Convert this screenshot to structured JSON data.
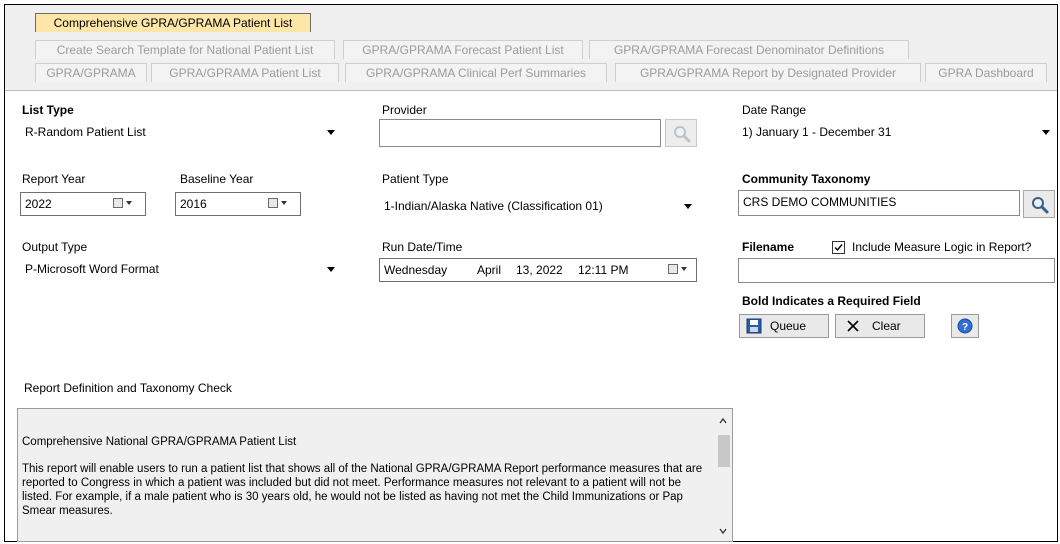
{
  "tabs": {
    "row1": [
      "Comprehensive GPRA/GPRAMA Patient List"
    ],
    "row2": [
      "Create Search Template for National Patient List",
      "GPRA/GPRAMA Forecast Patient List",
      "GPRA/GPRAMA Forecast Denominator Definitions"
    ],
    "row3": [
      "GPRA/GPRAMA",
      "GPRA/GPRAMA Patient List",
      "GPRA/GPRAMA Clinical Perf Summaries",
      "GPRA/GPRAMA Report by Designated Provider",
      "GPRA Dashboard"
    ]
  },
  "list_type": {
    "label": "List Type",
    "value": "R-Random Patient List"
  },
  "provider": {
    "label": "Provider",
    "value": ""
  },
  "date_range": {
    "label": "Date Range",
    "value": "1) January 1 - December 31"
  },
  "report_year": {
    "label": "Report Year",
    "value": "2022"
  },
  "baseline_year": {
    "label": "Baseline Year",
    "value": "2016"
  },
  "patient_type": {
    "label": "Patient Type",
    "value": "1-Indian/Alaska Native (Classification 01)"
  },
  "community_taxonomy": {
    "label": "Community Taxonomy",
    "value": "CRS DEMO COMMUNITIES"
  },
  "output_type": {
    "label": "Output Type",
    "value": "P-Microsoft Word Format"
  },
  "run_datetime": {
    "label": "Run Date/Time",
    "day": "Wednesday",
    "month": "April",
    "date": "13, 2022",
    "time": "12:11 PM"
  },
  "filename": {
    "label": "Filename",
    "value": ""
  },
  "include_logic": {
    "label": "Include Measure Logic in Report?",
    "checked": true
  },
  "required_note": "Bold Indicates a Required Field",
  "buttons": {
    "queue": "Queue",
    "clear": "Clear"
  },
  "report_def": {
    "label": "Report Definition and Taxonomy Check",
    "title": "Comprehensive National GPRA/GPRAMA Patient List",
    "body": "This report will enable users to run a patient list that shows all of the National GPRA/GPRAMA Report performance measures that are reported to Congress in which a patient was included but did not meet. Performance measures not relevant to a patient will not be listed.  For example, if a male patient who is 30 years old, he would not be listed as having not met the Child Immunizations or Pap Smear measures."
  },
  "colors": {
    "active_tab": "#fde6a8",
    "inactive_tab_text": "#9b9b9b",
    "textarea_bg": "#f0f0f0"
  }
}
